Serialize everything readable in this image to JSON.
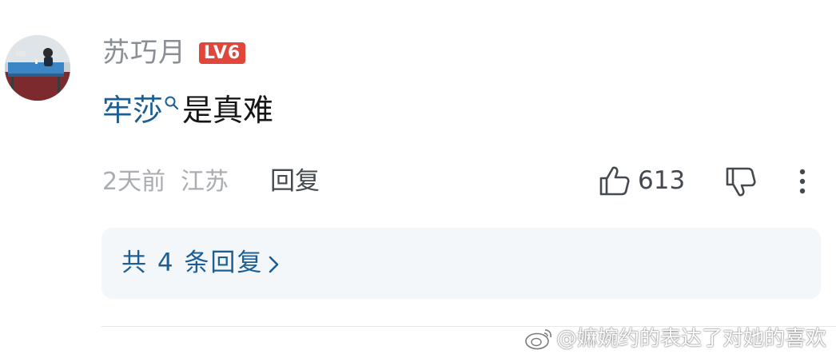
{
  "comment": {
    "username": "苏巧月",
    "level_badge": "LV6",
    "topic_link": "牢莎",
    "body_text": "是真难",
    "time": "2天前",
    "location": "江苏",
    "reply_label": "回复",
    "like_count": "613"
  },
  "replies": {
    "label": "共 4 条回复"
  },
  "watermark": {
    "text": "@嫲婉约的表达了对她的喜欢"
  },
  "icons": {
    "topic": "search-icon",
    "like": "thumbs-up-icon",
    "dislike": "thumbs-down-icon",
    "more": "more-vertical-icon",
    "replies": "chevron-right-icon"
  },
  "colors": {
    "link": "#1d5f93",
    "badge": "#e0473a",
    "meta": "#a9adb2",
    "reply_box_bg": "#f3f7f9"
  }
}
